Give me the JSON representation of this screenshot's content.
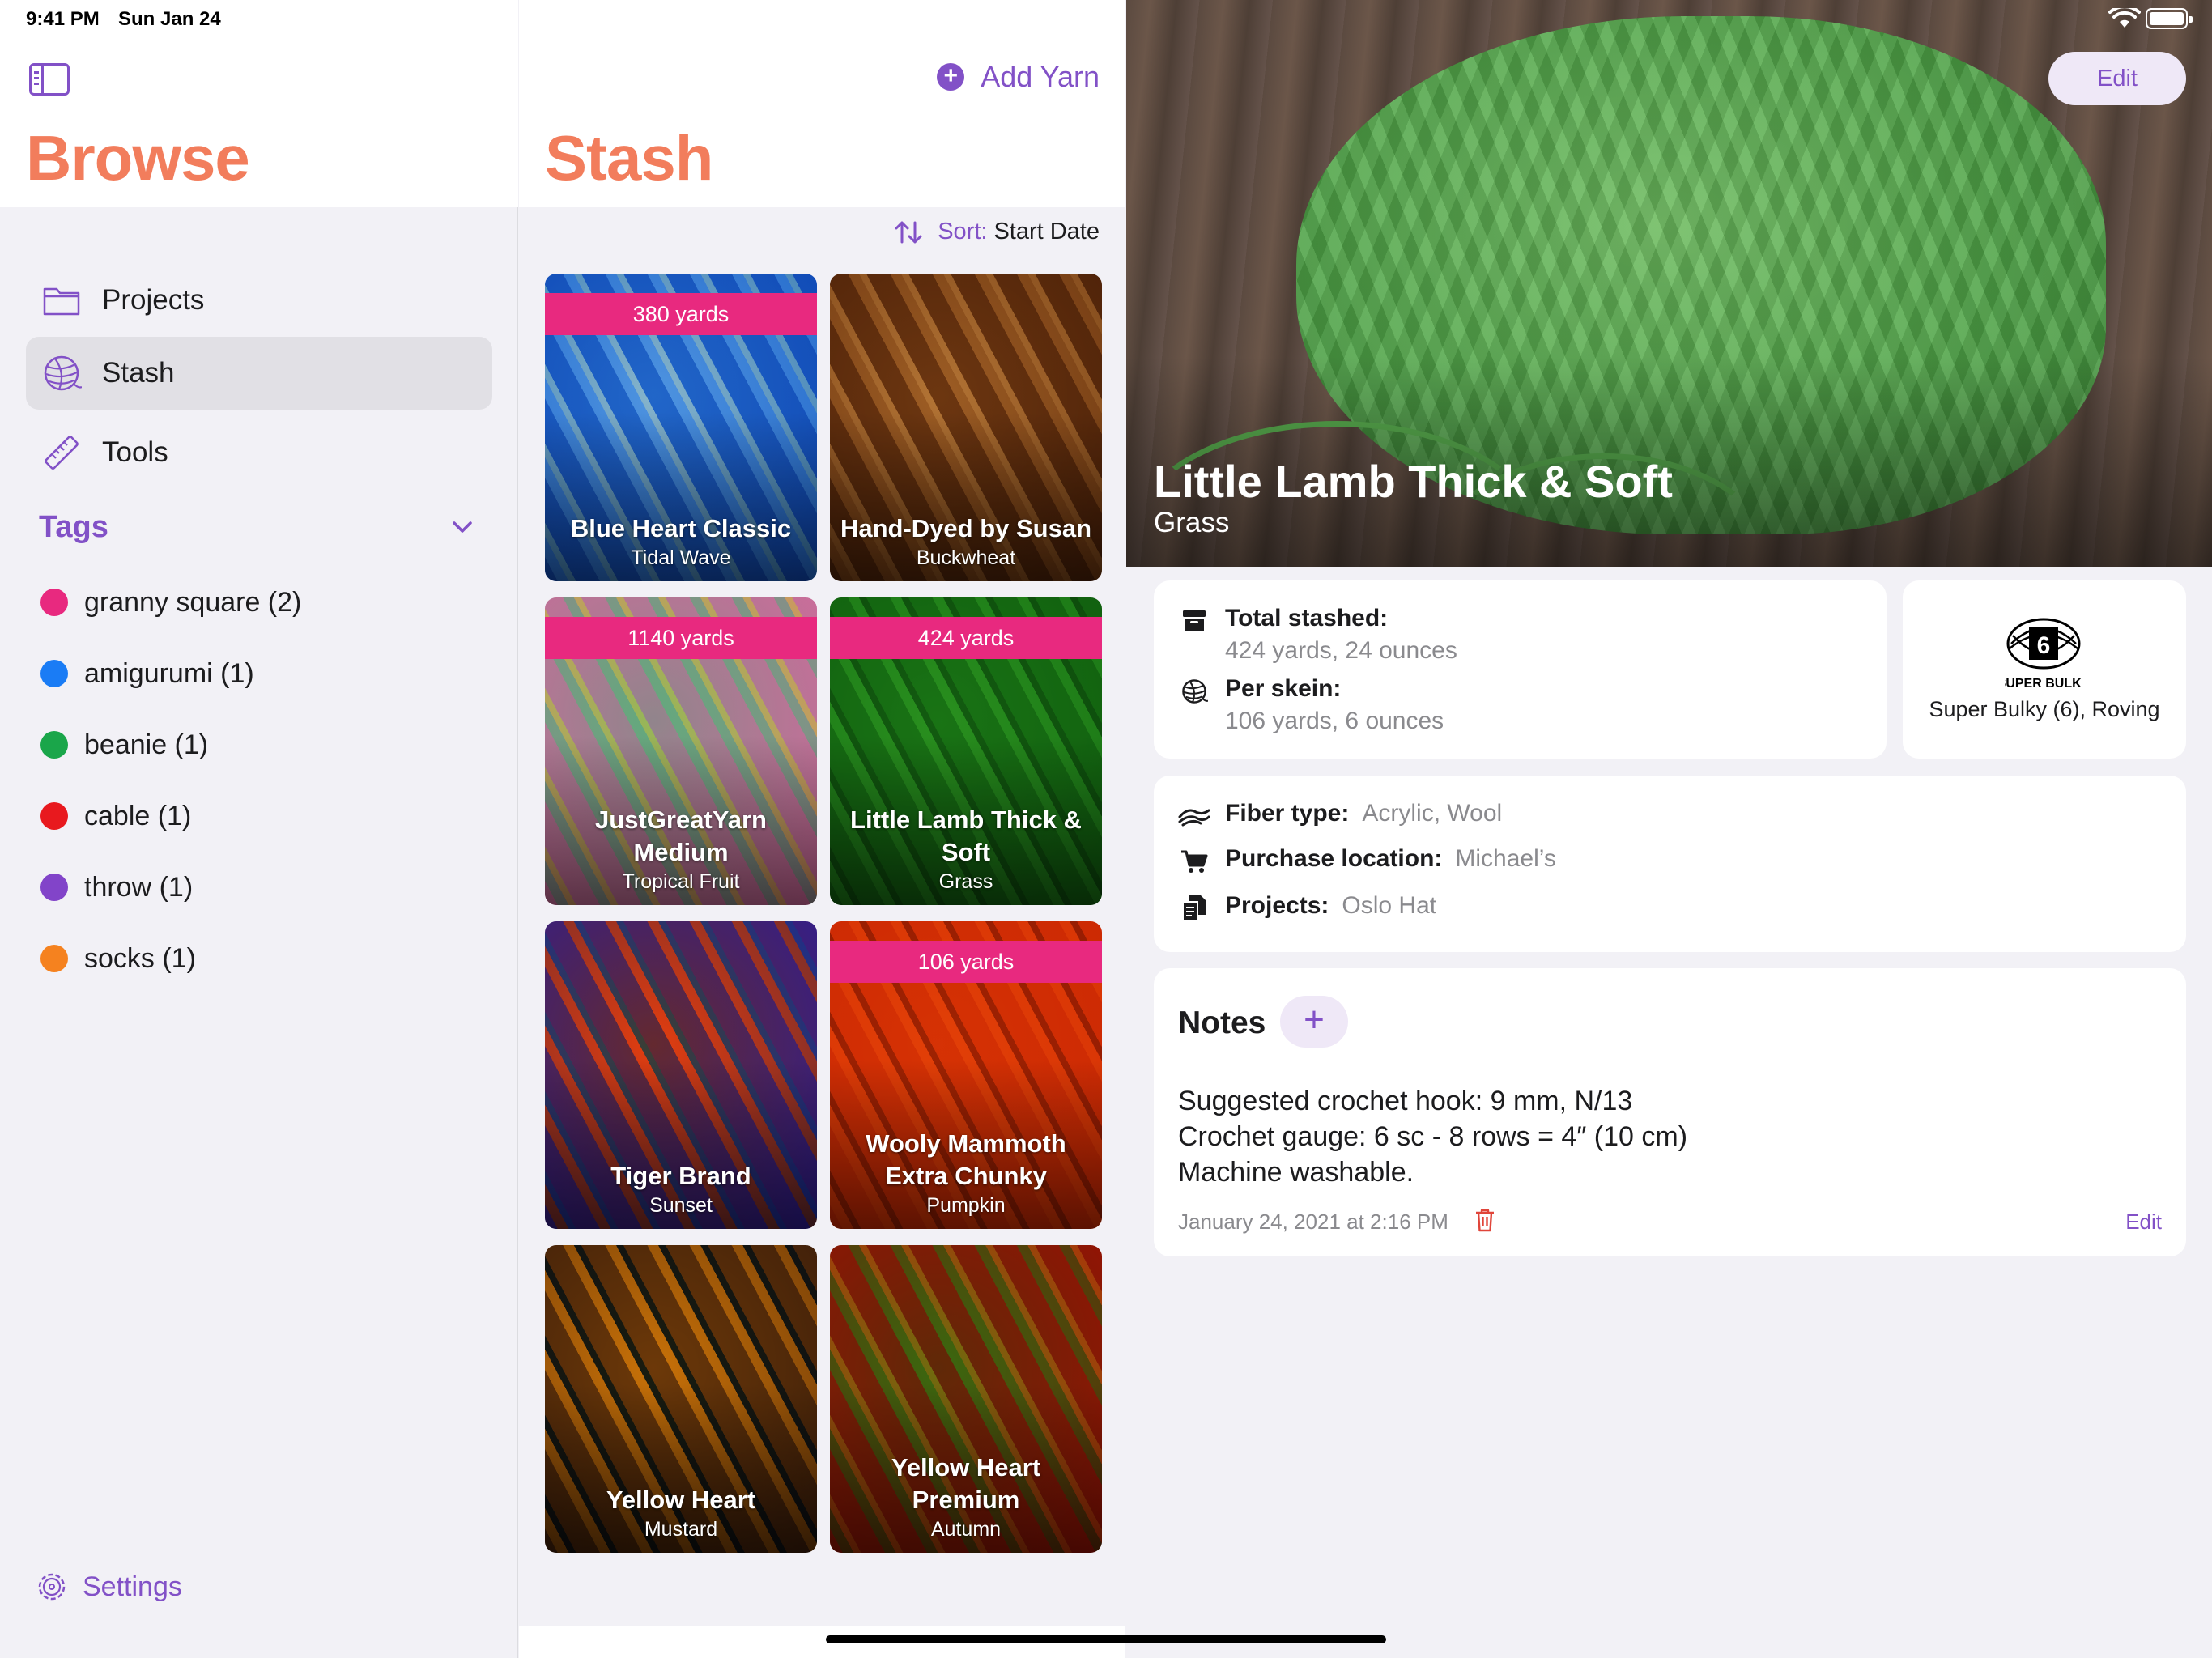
{
  "status_bar": {
    "time": "9:41 PM",
    "date": "Sun Jan 24"
  },
  "sidebar": {
    "title": "Browse",
    "nav": [
      {
        "label": "Projects",
        "icon": "folder-icon",
        "selected": false
      },
      {
        "label": "Stash",
        "icon": "yarn-ball-icon",
        "selected": true
      },
      {
        "label": "Tools",
        "icon": "ruler-icon",
        "selected": false
      }
    ],
    "tags_header": "Tags",
    "tags": [
      {
        "label": "granny square (2)",
        "color": "#e8297f"
      },
      {
        "label": "amigurumi (1)",
        "color": "#1a7cf5"
      },
      {
        "label": "beanie (1)",
        "color": "#1aa64a"
      },
      {
        "label": "cable (1)",
        "color": "#e8191e"
      },
      {
        "label": "throw (1)",
        "color": "#8244c9"
      },
      {
        "label": "socks (1)",
        "color": "#f5821f"
      }
    ],
    "settings_label": "Settings"
  },
  "stash": {
    "title": "Stash",
    "add_label": "Add Yarn",
    "sort_key": "Sort:",
    "sort_value": "Start Date",
    "cards": [
      {
        "yards": "380 yards",
        "name": "Blue Heart Classic",
        "color": "Tidal Wave",
        "swatch": [
          "#3c86d6",
          "#8dc2ef",
          "#f2ecd9"
        ]
      },
      {
        "yards": "",
        "name": "Hand-Dyed by Susan",
        "color": "Buckwheat",
        "swatch": [
          "#8a5a2c",
          "#c89a60",
          "#e3bf8b"
        ]
      },
      {
        "yards": "1140 yards",
        "name": "JustGreatYarn Medium",
        "color": "Tropical Fruit",
        "swatch": [
          "#e9a3c8",
          "#9fd0b2",
          "#efe07d"
        ]
      },
      {
        "yards": "424 yards",
        "name": "Little Lamb Thick & Soft",
        "color": "Grass",
        "swatch": [
          "#3f9a3c",
          "#66bf58",
          "#2f7a2f"
        ]
      },
      {
        "yards": "",
        "name": "Tiger Brand",
        "color": "Sunset",
        "swatch": [
          "#6a54c4",
          "#f07d3e",
          "#3f7ed0"
        ]
      },
      {
        "yards": "106 yards",
        "name": "Wooly Mammoth Extra Chunky",
        "color": "Pumpkin",
        "swatch": [
          "#e3641b",
          "#f07f2b",
          "#a8450f"
        ]
      },
      {
        "yards": "",
        "name": "Yellow Heart",
        "color": "Mustard",
        "swatch": [
          "#7a5532",
          "#e2aa2c",
          "#1c2a5c"
        ]
      },
      {
        "yards": "",
        "name": "Yellow Heart Premium",
        "color": "Autumn",
        "swatch": [
          "#c7401f",
          "#7aa33e",
          "#e8a83a"
        ]
      }
    ]
  },
  "detail": {
    "title": "Little Lamb Thick & Soft",
    "subtitle": "Grass",
    "edit_label": "Edit",
    "total_key": "Total stashed:",
    "total_val": "424 yards, 24 ounces",
    "skein_key": "Per skein:",
    "skein_val": "106 yards, 6 ounces",
    "weight_number": "6",
    "weight_badge": "SUPER BULKY",
    "weight_text": "Super Bulky (6), Roving",
    "fiber_key": "Fiber type:",
    "fiber_val": "Acrylic, Wool",
    "purchase_key": "Purchase location:",
    "purchase_val": "Michael’s",
    "projects_key": "Projects:",
    "projects_val": "Oslo Hat",
    "notes_title": "Notes",
    "notes_add": "+",
    "notes_lines": [
      "Suggested crochet hook: 9 mm, N/13",
      "Crochet gauge: 6 sc - 8 rows = 4″ (10 cm)",
      "Machine washable."
    ],
    "notes_date": "January 24, 2021 at 2:16 PM",
    "notes_edit": "Edit"
  },
  "colors": {
    "accent": "#8251c7",
    "title": "#f27d5c",
    "banner": "#e8297f"
  }
}
